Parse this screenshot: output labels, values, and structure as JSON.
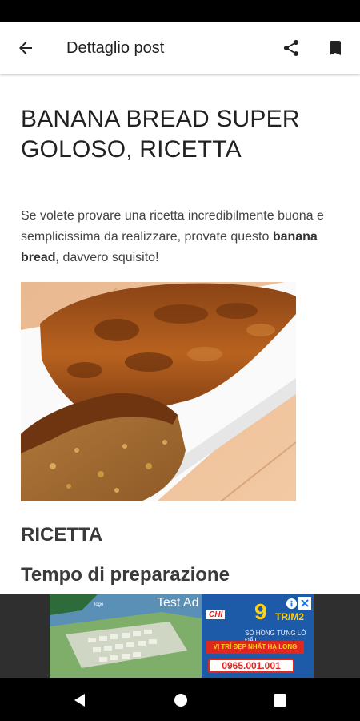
{
  "app_bar": {
    "title": "Dettaglio post",
    "icons": {
      "back": "arrow-back-icon",
      "share": "share-icon",
      "bookmark": "bookmark-icon"
    }
  },
  "post": {
    "title": "BANANA BREAD SUPER GOLOSO, RICETTA",
    "intro_before": "Se volete provare una ricetta incredibilmente buona e semplicissima da realizzare, provate questo ",
    "intro_bold": "banana bread,",
    "intro_after": " davvero squisito!",
    "image_subject": "banana bread loaf with a cut slice on a white plate",
    "section_heading": "RICETTA",
    "sub_heading": "Tempo di preparazione"
  },
  "ad": {
    "label": "Test Ad",
    "chi": "CHỈ",
    "price": "9",
    "unit": "TR/M2",
    "sub": "SỔ HỒNG TỪNG LÔ ĐẤT",
    "tagline": "VỊ TRÍ ĐẸP NHẤT HẠ LONG",
    "phone": "0965.001.001"
  },
  "nav": {
    "back": "nav-back-icon",
    "home": "nav-home-icon",
    "recents": "nav-recents-icon"
  },
  "colors": {
    "status_bar": "#000000",
    "app_bar": "#ffffff",
    "ad_background": "#2f2f2f",
    "nav_bar": "#000000"
  }
}
